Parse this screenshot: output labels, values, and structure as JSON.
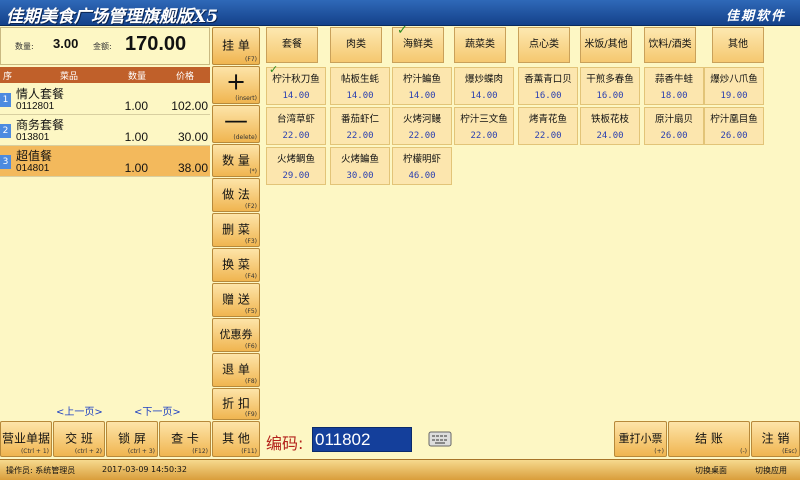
{
  "title": "佳期美食广场管理旗舰版X5",
  "brand": "佳期软件",
  "summary": {
    "qty_label": "数量:",
    "qty": "3.00",
    "amount_label": "金额:",
    "amount": "170.00"
  },
  "order": {
    "headers": {
      "idx": "序",
      "name": "菜品",
      "qty": "数量",
      "price": "价格"
    },
    "rows": [
      {
        "idx": "1",
        "name": "情人套餐",
        "code": "0112801",
        "qty": "1.00",
        "price": "102.00"
      },
      {
        "idx": "2",
        "name": "商务套餐",
        "code": "013801",
        "qty": "1.00",
        "price": "30.00"
      },
      {
        "idx": "3",
        "name": "超值餐",
        "code": "014801",
        "qty": "1.00",
        "price": "38.00"
      }
    ],
    "prev_page": "<上一页>",
    "next_page": "<下一页>"
  },
  "side_buttons": [
    {
      "label": "挂 单",
      "hotkey": "(F7)"
    },
    {
      "label": "+",
      "hotkey": "(insert)"
    },
    {
      "label": "—",
      "hotkey": "(delete)"
    },
    {
      "label": "数 量",
      "hotkey": "(*)"
    },
    {
      "label": "做 法",
      "hotkey": "(F2)"
    },
    {
      "label": "删 菜",
      "hotkey": "(F3)"
    },
    {
      "label": "换 菜",
      "hotkey": "(F4)"
    },
    {
      "label": "赠 送",
      "hotkey": "(F5)"
    },
    {
      "label": "优惠券",
      "hotkey": "(F6)"
    },
    {
      "label": "退 单",
      "hotkey": "(F8)"
    },
    {
      "label": "折 扣",
      "hotkey": "(F9)"
    },
    {
      "label": "其 他",
      "hotkey": "(F11)"
    }
  ],
  "bottom_buttons": [
    {
      "label": "营业单据",
      "hotkey": "(Ctrl + 1)"
    },
    {
      "label": "交 班",
      "hotkey": "(ctrl + 2)"
    },
    {
      "label": "锁 屏",
      "hotkey": "(ctrl + 3)"
    },
    {
      "label": "查 卡",
      "hotkey": "(F12)"
    }
  ],
  "categories": [
    {
      "label": "套餐"
    },
    {
      "label": "肉类"
    },
    {
      "label": "海鲜类",
      "checked": true
    },
    {
      "label": "蔬菜类"
    },
    {
      "label": "点心类"
    },
    {
      "label": "米饭/其他"
    },
    {
      "label": "饮料/酒类"
    },
    {
      "label": "其他"
    }
  ],
  "dishes": [
    {
      "name": "柠汁秋刀鱼",
      "price": "14.00",
      "checked": true
    },
    {
      "name": "帖板生蚝",
      "price": "14.00"
    },
    {
      "name": "柠汁鳊鱼",
      "price": "14.00"
    },
    {
      "name": "爆炒蝶肉",
      "price": "14.00"
    },
    {
      "name": "香薰青口贝",
      "price": "16.00"
    },
    {
      "name": "干煎多春鱼",
      "price": "16.00"
    },
    {
      "name": "蒜香牛蛙",
      "price": "18.00"
    },
    {
      "name": "爆炒八爪鱼",
      "price": "19.00"
    },
    {
      "name": "台湾草虾",
      "price": "22.00"
    },
    {
      "name": "番茄虾仁",
      "price": "22.00"
    },
    {
      "name": "火烤河鳗",
      "price": "22.00"
    },
    {
      "name": "柠汁三文鱼",
      "price": "22.00"
    },
    {
      "name": "烤青花鱼",
      "price": "22.00"
    },
    {
      "name": "铁板花枝",
      "price": "24.00"
    },
    {
      "name": "原汁扇贝",
      "price": "26.00"
    },
    {
      "name": "柠汁凰目鱼",
      "price": "26.00"
    },
    {
      "name": "火烤鲷鱼",
      "price": "29.00"
    },
    {
      "name": "火烤鳊鱼",
      "price": "30.00"
    },
    {
      "name": "柠檬明虾",
      "price": "46.00"
    }
  ],
  "code_entry": {
    "label": "编码:",
    "value": "011802"
  },
  "action_buttons": [
    {
      "label": "重打小票",
      "hotkey": "(+)"
    },
    {
      "label": "结 账",
      "hotkey": "(-)"
    },
    {
      "label": "注 销",
      "hotkey": "(Esc)"
    }
  ],
  "status": {
    "operator": "操作员: 系统管理员",
    "datetime": "2017-03-09 14:50:32",
    "switch_desktop": "切换桌面",
    "switch_app": "切换应用"
  },
  "colors": {
    "titlebar": "#1f55a6",
    "panel": "#fdf7c4",
    "button": "#f0b550",
    "selected_row": "#f3b95c",
    "price_text": "#2a3fb0"
  }
}
